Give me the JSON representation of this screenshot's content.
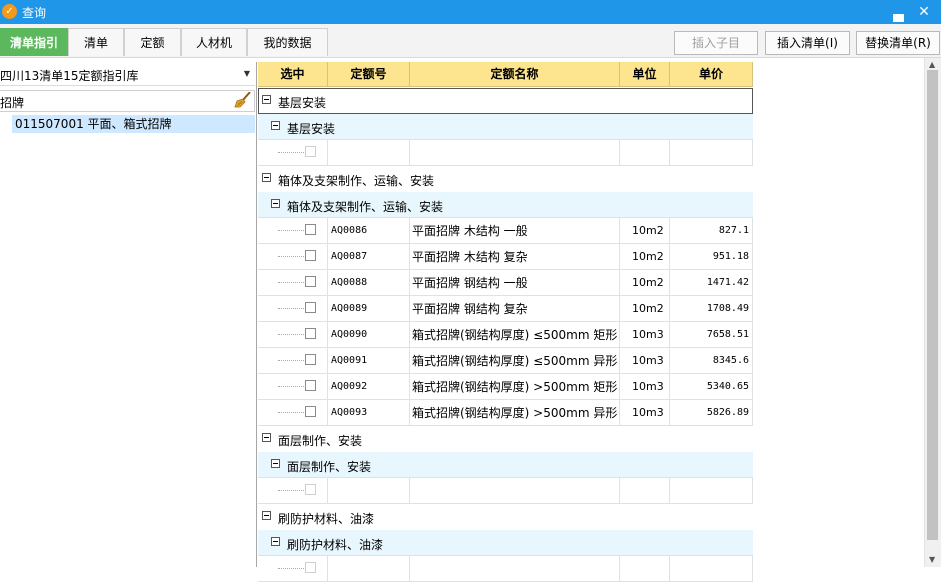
{
  "window": {
    "title": "查询",
    "icon": "app-logo-icon",
    "minimize_icon": "minimize-icon",
    "close_icon": "close-icon"
  },
  "tabs": [
    {
      "label": "清单指引",
      "active": true
    },
    {
      "label": "清单",
      "active": false
    },
    {
      "label": "定额",
      "active": false
    },
    {
      "label": "人材机",
      "active": false
    },
    {
      "label": "我的数据",
      "active": false
    }
  ],
  "toolbar": {
    "insert_child": "插入子目",
    "insert_list": "插入清单(I)",
    "replace_list": "替换清单(R)"
  },
  "left_panel": {
    "library": "四川13清单15定额指引库",
    "search_value": "招牌",
    "broom_icon": "clear-brush-icon",
    "tree_item": "011507001  平面、箱式招牌"
  },
  "table": {
    "headers": [
      "选中",
      "定额号",
      "定额名称",
      "单位",
      "单价"
    ],
    "groups": [
      {
        "title": "基层安装",
        "subgroups": [
          {
            "title": "基层安装",
            "rows": [
              {
                "code": "",
                "name": "",
                "unit": "",
                "price": "",
                "empty": true
              }
            ]
          }
        ]
      },
      {
        "title": "箱体及支架制作、运输、安装",
        "subgroups": [
          {
            "title": "箱体及支架制作、运输、安装",
            "rows": [
              {
                "code": "AQ0086",
                "name": "平面招牌 木结构 一般",
                "unit": "10m2",
                "price": "827.1"
              },
              {
                "code": "AQ0087",
                "name": "平面招牌 木结构 复杂",
                "unit": "10m2",
                "price": "951.18"
              },
              {
                "code": "AQ0088",
                "name": "平面招牌 钢结构 一般",
                "unit": "10m2",
                "price": "1471.42"
              },
              {
                "code": "AQ0089",
                "name": "平面招牌 钢结构 复杂",
                "unit": "10m2",
                "price": "1708.49"
              },
              {
                "code": "AQ0090",
                "name": "箱式招牌(钢结构厚度) ≤500mm 矩形",
                "unit": "10m3",
                "price": "7658.51"
              },
              {
                "code": "AQ0091",
                "name": "箱式招牌(钢结构厚度) ≤500mm 异形",
                "unit": "10m3",
                "price": "8345.6"
              },
              {
                "code": "AQ0092",
                "name": "箱式招牌(钢结构厚度) >500mm 矩形",
                "unit": "10m3",
                "price": "5340.65"
              },
              {
                "code": "AQ0093",
                "name": "箱式招牌(钢结构厚度) >500mm 异形",
                "unit": "10m3",
                "price": "5826.89"
              }
            ]
          }
        ]
      },
      {
        "title": "面层制作、安装",
        "subgroups": [
          {
            "title": "面层制作、安装",
            "rows": [
              {
                "code": "",
                "name": "",
                "unit": "",
                "price": "",
                "empty": true
              }
            ]
          }
        ]
      },
      {
        "title": "刷防护材料、油漆",
        "subgroups": [
          {
            "title": "刷防护材料、油漆",
            "rows": [
              {
                "code": "",
                "name": "",
                "unit": "",
                "price": "",
                "empty": true
              }
            ]
          }
        ]
      }
    ]
  },
  "colors": {
    "titlebar": "#1f96e8",
    "active_tab": "#5cb85c",
    "header": "#fde58f",
    "subgroup": "#e8f7fd",
    "selected_tree": "#cde8ff"
  }
}
